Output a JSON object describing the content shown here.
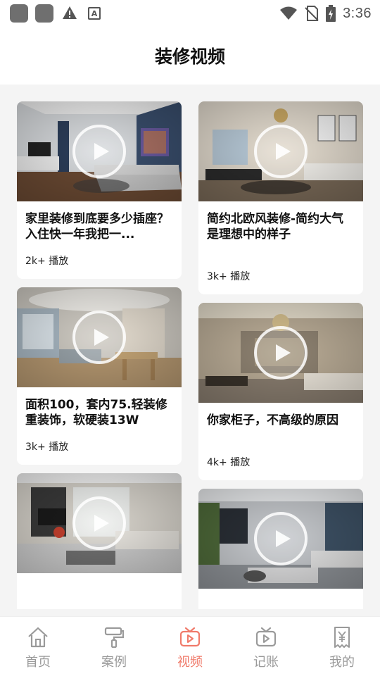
{
  "status_bar": {
    "time": "3:36"
  },
  "header": {
    "title": "装修视频"
  },
  "videos": [
    {
      "title": "家里装修到底要多少插座？入住快一年我把一...",
      "plays": "2k+ 播放"
    },
    {
      "title": "简约北欧风装修-简约大气是理想中的样子",
      "plays": "3k+ 播放"
    },
    {
      "title": "面积100，套内75.轻装修重装饰，软硬装13W",
      "plays": "3k+ 播放"
    },
    {
      "title": "你家柜子，不高级的原因",
      "plays": "4k+ 播放"
    },
    {
      "title": "",
      "plays": ""
    },
    {
      "title": "",
      "plays": ""
    }
  ],
  "bottom_nav": [
    {
      "label": "首页",
      "icon": "home-icon"
    },
    {
      "label": "案例",
      "icon": "paint-roller-icon"
    },
    {
      "label": "视频",
      "icon": "tv-play-icon"
    },
    {
      "label": "记账",
      "icon": "tv-play-icon"
    },
    {
      "label": "我的",
      "icon": "receipt-yen-icon"
    }
  ],
  "colors": {
    "accent": "#f07a6a",
    "inactive": "#9a9a9a"
  }
}
